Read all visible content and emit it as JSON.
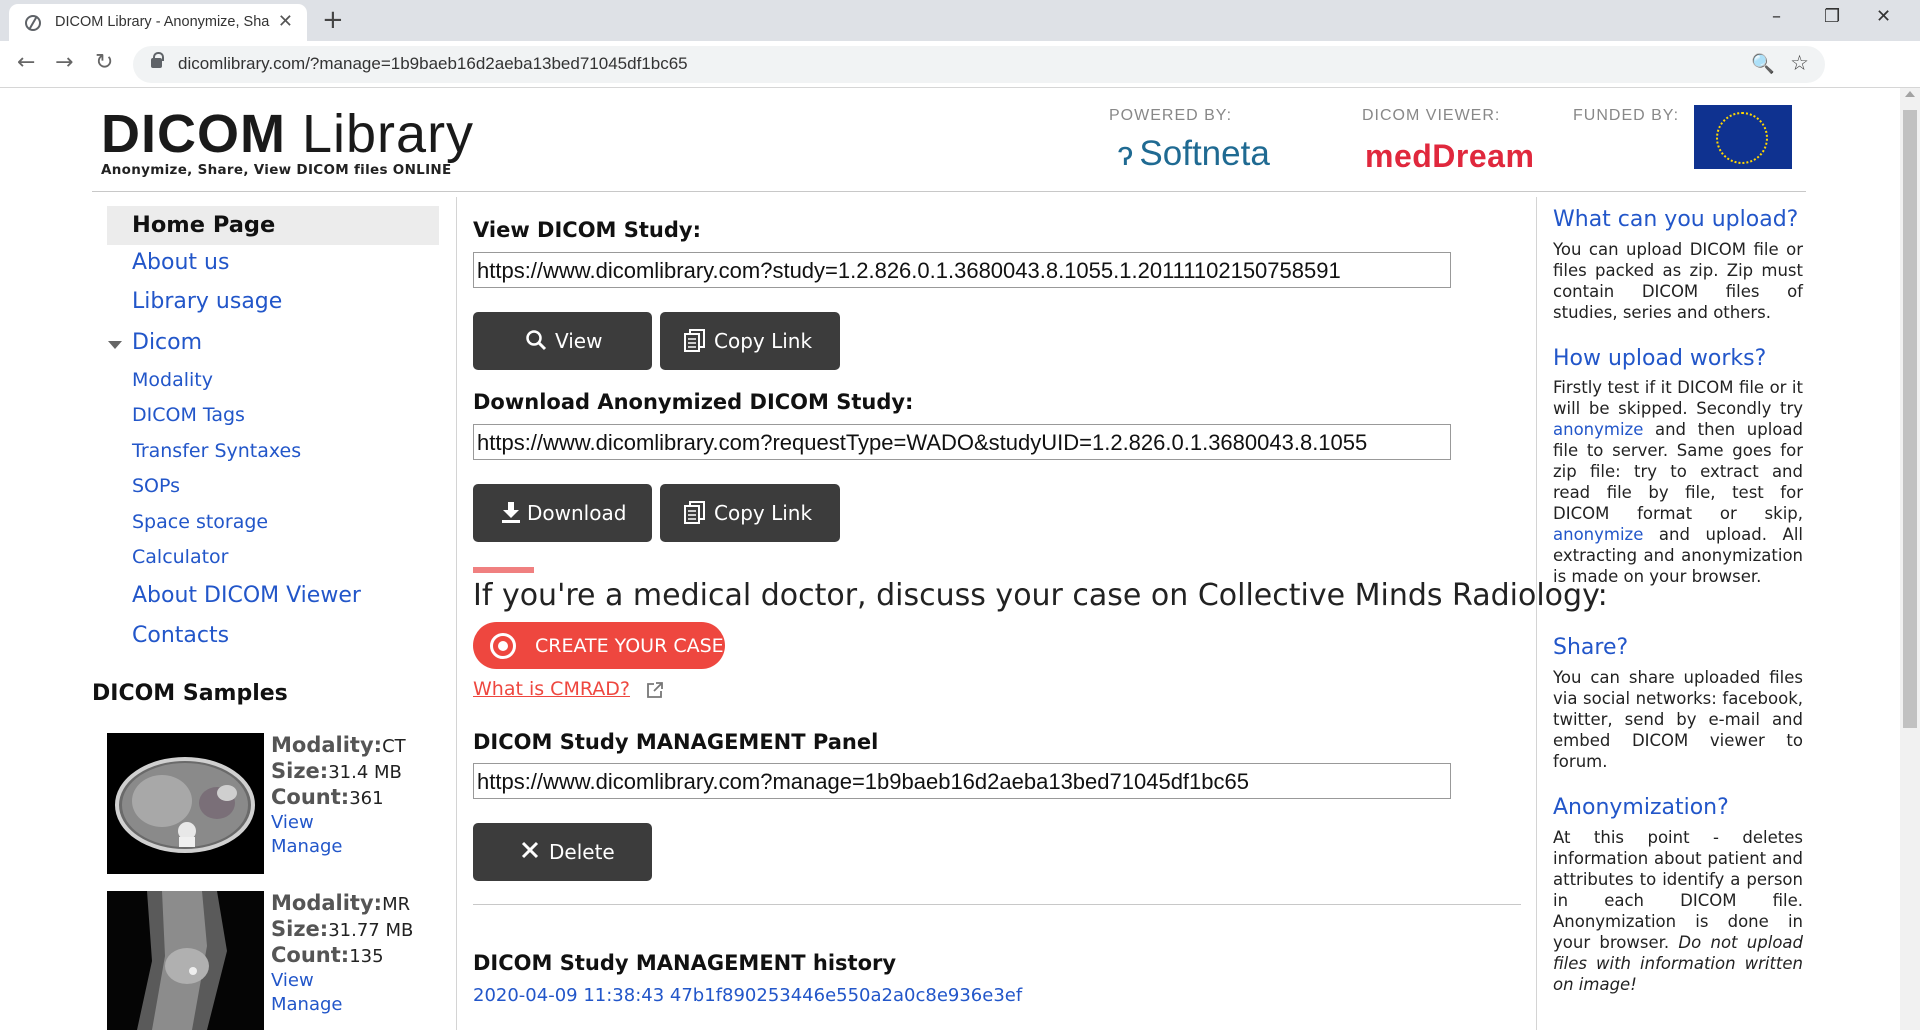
{
  "browser": {
    "tab_title": "DICOM Library - Anonymize, Sha",
    "tab_close": "✕",
    "new_tab": "+",
    "url": "dicomlibrary.com/?manage=1b9baeb16d2aeba13bed71045df1bc65",
    "window_controls": {
      "minimize": "–",
      "maximize": "❐",
      "close": "✕"
    },
    "nav": {
      "back": "←",
      "forward": "→",
      "reload": "↻"
    },
    "zoom_icon": "🔍",
    "star_icon": "☆"
  },
  "header": {
    "logo_bold": "DICOM",
    "logo_light": " Library",
    "tagline": "Anonymize, Share, View DICOM files ONLINE",
    "powered_label": "POWERED BY:",
    "powered_brand": "Softneta",
    "viewer_label": "DICOM VIEWER:",
    "viewer_brand": "medDream",
    "funded_label": "FUNDED BY:"
  },
  "nav": {
    "home": "Home Page",
    "about": "About us",
    "usage": "Library usage",
    "dicom": "Dicom",
    "dicom_items": [
      "Modality",
      "DICOM Tags",
      "Transfer Syntaxes",
      "SOPs",
      "Space storage",
      "Calculator"
    ],
    "viewer": "About DICOM Viewer",
    "contacts": "Contacts"
  },
  "samples": {
    "title": "DICOM Samples",
    "items": [
      {
        "modality_key": "Modality:",
        "modality": "CT",
        "size_key": "Size:",
        "size": "31.4 MB",
        "count_key": "Count:",
        "count": "361",
        "view": "View",
        "manage": "Manage"
      },
      {
        "modality_key": "Modality:",
        "modality": "MR",
        "size_key": "Size:",
        "size": "31.77 MB",
        "count_key": "Count:",
        "count": "135",
        "view": "View",
        "manage": "Manage"
      }
    ]
  },
  "main": {
    "view_title": "View DICOM Study:",
    "view_url": "https://www.dicomlibrary.com?study=1.2.826.0.1.3680043.8.1055.1.20111102150758591",
    "view_btn": "View",
    "copy_btn": "Copy Link",
    "download_title": "Download Anonymized DICOM Study:",
    "download_url": "https://www.dicomlibrary.com?requestType=WADO&studyUID=1.2.826.0.1.3680043.8.1055",
    "download_btn": "Download",
    "copy_btn2": "Copy Link",
    "cm_heading": "If you're a medical doctor, discuss your case on Collective Minds Radiology:",
    "create_case": "CREATE YOUR CASE",
    "cmrad_link": "What is CMRAD?",
    "manage_title": "DICOM Study MANAGEMENT Panel",
    "manage_url": "https://www.dicomlibrary.com?manage=1b9baeb16d2aeba13bed71045df1bc65",
    "delete_btn": "Delete",
    "history_title": "DICOM Study MANAGEMENT history",
    "history_entry": "2020-04-09 11:38:43 47b1f890253446e550a2a0c8e936e3ef"
  },
  "faq": {
    "q1": "What can you upload?",
    "a1": "You can upload DICOM file or files packed as zip. Zip must contain DICOM files of studies, series and others.",
    "q2": "How upload works?",
    "a2_1": "Firstly test if it DICOM file or it will be skipped. Secondly try ",
    "a2_link1": "anonymize",
    "a2_2": " and then upload file to server. Same goes for zip file: try to extract and read file by file, test for DICOM format or skip, ",
    "a2_link2": "anonymize",
    "a2_3": " and upload. All extracting and anonymization is made on your browser.",
    "q3": "Share?",
    "a3": "You can share uploaded files via social networks: facebook, twitter, send by e-mail and embed DICOM viewer to forum.",
    "q4": "Anonymization?",
    "a4": "At this point - deletes information about patient and attributes to identify a person in each DICOM file. Anonymization is done in your browser.",
    "a4_note": "Do not upload files with information written on image!"
  },
  "icons": {
    "search": "search-icon",
    "copy": "copy-icon",
    "download": "download-icon",
    "delete": "close-icon",
    "external": "external-link-icon"
  },
  "colors": {
    "link": "#2256c9",
    "button": "#3c3c3c",
    "cmrad_red": "#ee473f",
    "softneta": "#1f6a92",
    "meddream": "#e0283d",
    "eu_blue": "#0f3290"
  }
}
